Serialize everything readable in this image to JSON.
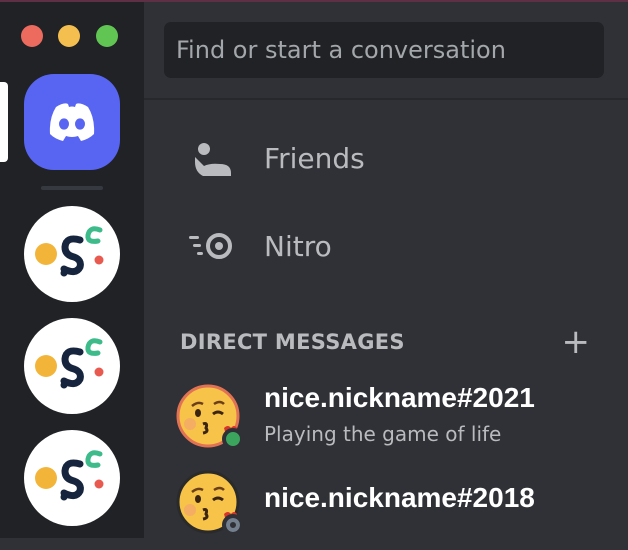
{
  "window": {
    "controls": [
      "close",
      "minimize",
      "zoom"
    ],
    "colors": {
      "close": "#ed6a5e",
      "minimize": "#f5bf4f",
      "zoom": "#61c554"
    }
  },
  "rail": {
    "home_icon": "discord-logo-icon",
    "home_color": "#5865f2",
    "servers": [
      {
        "icon": "server-logo-icon"
      },
      {
        "icon": "server-logo-icon"
      },
      {
        "icon": "server-logo-icon"
      }
    ]
  },
  "search": {
    "placeholder": "Find or start a conversation"
  },
  "nav": {
    "friends": {
      "label": "Friends",
      "icon": "friends-icon"
    },
    "nitro": {
      "label": "Nitro",
      "icon": "nitro-icon"
    }
  },
  "direct_messages": {
    "title": "DIRECT MESSAGES",
    "add_label": "+",
    "items": [
      {
        "name": "nice.nickname#2021",
        "activity": "Playing the game of life",
        "status": "online",
        "avatar": "kissing-face-emoji"
      },
      {
        "name": "nice.nickname#2018",
        "activity": "",
        "status": "offline",
        "avatar": "kissing-face-emoji"
      }
    ]
  }
}
